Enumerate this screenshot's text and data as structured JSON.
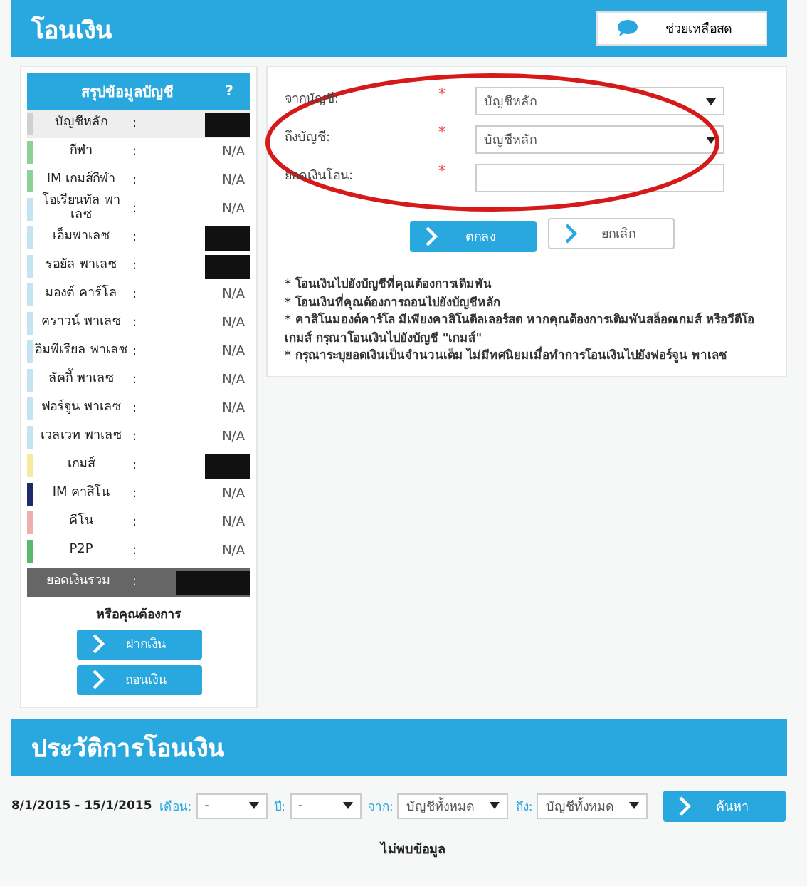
{
  "header": {
    "title": "โอนเงิน",
    "help_button": "ช่วยเหลือสด"
  },
  "summary": {
    "title": "สรุปข้อมูลบัญชี",
    "help": "?",
    "rows": [
      {
        "label": "บัญชีหลัก",
        "color": "#d0d0d0",
        "kind": "redacted",
        "highlighted": true
      },
      {
        "label": "กีฬา",
        "color": "#8fcf98",
        "kind": "value",
        "value": "N/A",
        "highlighted": false
      },
      {
        "label": "IM เกมส์กีฬา",
        "color": "#8fcf98",
        "kind": "value",
        "value": "N/A",
        "highlighted": false
      },
      {
        "label": "โอเรียนทัล พาเลซ",
        "color": "#c4e4f2",
        "kind": "value",
        "value": "N/A",
        "highlighted": false
      },
      {
        "label": "เอ็มพาเลซ",
        "color": "#c4e4f2",
        "kind": "redacted",
        "highlighted": false
      },
      {
        "label": "รอยัล พาเลซ",
        "color": "#c4e4f2",
        "kind": "redacted",
        "highlighted": false
      },
      {
        "label": "มองต์ คาร์โล",
        "color": "#c4e4f2",
        "kind": "value",
        "value": "N/A",
        "highlighted": false
      },
      {
        "label": "คราวน์ พาเลซ",
        "color": "#c4e4f2",
        "kind": "value",
        "value": "N/A",
        "highlighted": false
      },
      {
        "label": "อิมพีเรียล พาเลซ",
        "color": "#c4e4f2",
        "kind": "value",
        "value": "N/A",
        "highlighted": false
      },
      {
        "label": "ลัคกี้ พาเลซ",
        "color": "#c4e4f2",
        "kind": "value",
        "value": "N/A",
        "highlighted": false
      },
      {
        "label": "ฟอร์จูน พาเลซ",
        "color": "#c4e4f2",
        "kind": "value",
        "value": "N/A",
        "highlighted": false
      },
      {
        "label": "เวลเวท พาเลซ",
        "color": "#c4e4f2",
        "kind": "value",
        "value": "N/A",
        "highlighted": false
      },
      {
        "label": "เกมส์",
        "color": "#f6ea9e",
        "kind": "redacted",
        "highlighted": false
      },
      {
        "label": "IM คาสิโน",
        "color": "#1e2a6a",
        "kind": "value",
        "value": "N/A",
        "highlighted": false
      },
      {
        "label": "คีโน",
        "color": "#f0afaf",
        "kind": "value",
        "value": "N/A",
        "highlighted": false
      },
      {
        "label": "P2P",
        "color": "#5cb870",
        "kind": "value",
        "value": "N/A",
        "highlighted": false
      }
    ],
    "separator": ":",
    "total": {
      "label": "ยอดเงินรวม",
      "separator": ":"
    },
    "more_label": "หรือคุณต้องการ",
    "actions": [
      "ฝากเงิน",
      "ถอนเงิน"
    ]
  },
  "transfer_form": {
    "fields": [
      {
        "kind": "select",
        "label": "จากบัญชี:",
        "value": "บัญชีหลัก",
        "required_mark": "*"
      },
      {
        "kind": "select",
        "label": "ถึงบัญชี:",
        "value": "บัญชีหลัก",
        "required_mark": "*"
      },
      {
        "kind": "input",
        "label": "ยอดเงินโอน:",
        "required_mark": "*"
      }
    ],
    "submit": "ตกลง",
    "cancel": "ยกเลิก",
    "notes": [
      "* โอนเงินไปยังบัญชีที่คุณต้องการเดิมพัน",
      "* โอนเงินที่คุณต้องการถอนไปยังบัญชีหลัก",
      "* คาสิโนมองต์คาร์โล มีเพียงคาสิโนดีลเลอร์สด หากคุณต้องการเดิมพันสล็อตเกมส์ หรือวีดีโอเกมส์ กรุณาโอนเงินไปยังบัญชี \"เกมส์\"",
      "* กรุณาระบุยอดเงินเป็นจำนวนเต็ม ไม่มีทศนิยมเมื่อทำการโอนเงินไปยังฟอร์จูน พาเลซ"
    ]
  },
  "history": {
    "title": "ประวัติการโอนเงิน",
    "date_range": "8/1/2015 - 15/1/2015",
    "filters": [
      {
        "label": "เดือน:",
        "value": "-"
      },
      {
        "label": "ปี:",
        "value": "-"
      },
      {
        "label": "จาก:",
        "value": "บัญชีทั้งหมด"
      },
      {
        "label": "ถึง:",
        "value": "บัญชีทั้งหมด"
      }
    ],
    "search": "ค้นหา",
    "empty": "ไม่พบข้อมูล"
  }
}
